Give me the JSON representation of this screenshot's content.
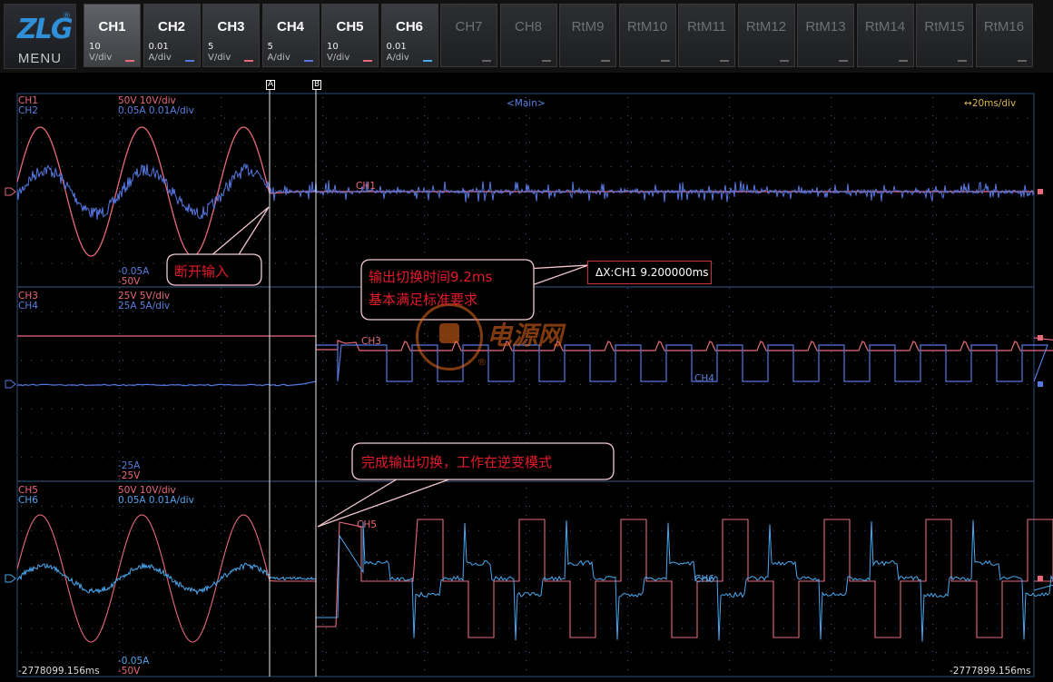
{
  "menu_label": "MENU",
  "logo_reg": "®",
  "logo_text": "ZLG",
  "channels": [
    {
      "name": "CH1",
      "value": "10",
      "unit": "V/div",
      "color": "#e8697a",
      "on": true,
      "active": true
    },
    {
      "name": "CH2",
      "value": "0.01",
      "unit": "A/div",
      "color": "#5577e0",
      "on": true
    },
    {
      "name": "CH3",
      "value": "5",
      "unit": "V/div",
      "color": "#e8697a",
      "on": true
    },
    {
      "name": "CH4",
      "value": "5",
      "unit": "A/div",
      "color": "#5577e0",
      "on": true
    },
    {
      "name": "CH5",
      "value": "10",
      "unit": "V/div",
      "color": "#e8697a",
      "on": true
    },
    {
      "name": "CH6",
      "value": "0.01",
      "unit": "A/div",
      "color": "#4aa8ee",
      "on": true
    },
    {
      "name": "CH7",
      "on": false
    },
    {
      "name": "CH8",
      "on": false
    },
    {
      "name": "RtM9",
      "on": false
    },
    {
      "name": "RtM10",
      "on": false
    },
    {
      "name": "RtM11",
      "on": false
    },
    {
      "name": "RtM12",
      "on": false
    },
    {
      "name": "RtM13",
      "on": false
    },
    {
      "name": "RtM14",
      "on": false
    },
    {
      "name": "RtM15",
      "on": false
    },
    {
      "name": "RtM16",
      "on": false
    }
  ],
  "cursors": {
    "a": "A",
    "b": "B"
  },
  "timebase": {
    "view": "<Main>",
    "scale": "20ms/div",
    "start": "-2778099.156ms",
    "end": "-2777899.156ms"
  },
  "panel1": {
    "ch_a": "CH1",
    "ch_a_scale": "50V   10V/div",
    "ch_b": "CH2",
    "ch_b_scale": "0.05A   0.01A/div",
    "bottom_b": "-0.05A",
    "bottom_a": "-50V",
    "trace_label": "CH1"
  },
  "panel2": {
    "ch_a": "CH3",
    "ch_a_scale": "25V   5V/div",
    "ch_b": "CH4",
    "ch_b_scale": "25A   5A/div",
    "bottom_b": "-25A",
    "bottom_a": "-25V",
    "trace_label_a": "CH3",
    "trace_label_b": "CH4"
  },
  "panel3": {
    "ch_a": "CH5",
    "ch_a_scale": "50V   10V/div",
    "ch_b": "CH6",
    "ch_b_scale": "0.05A   0.01A/div",
    "bottom_b": "-0.05A",
    "bottom_a": "-50V",
    "trace_label_a": "CH5",
    "trace_label_b": "CH6"
  },
  "annotations": {
    "disconnect": "断开输入",
    "switch_time_line1": "输出切换时间9.2ms",
    "switch_time_line2": "基本满足标准要求",
    "inverter": "完成输出切换，工作在逆变模式"
  },
  "measurement": "ΔX:CH1 9.200000ms",
  "watermark": "电源网",
  "watermark_reg": "®",
  "colors": {
    "red": "#e8697a",
    "blue": "#5577e0",
    "lightblue": "#4aa8ee",
    "grid": "#3a5a8a",
    "accent": "#e41a2a"
  }
}
